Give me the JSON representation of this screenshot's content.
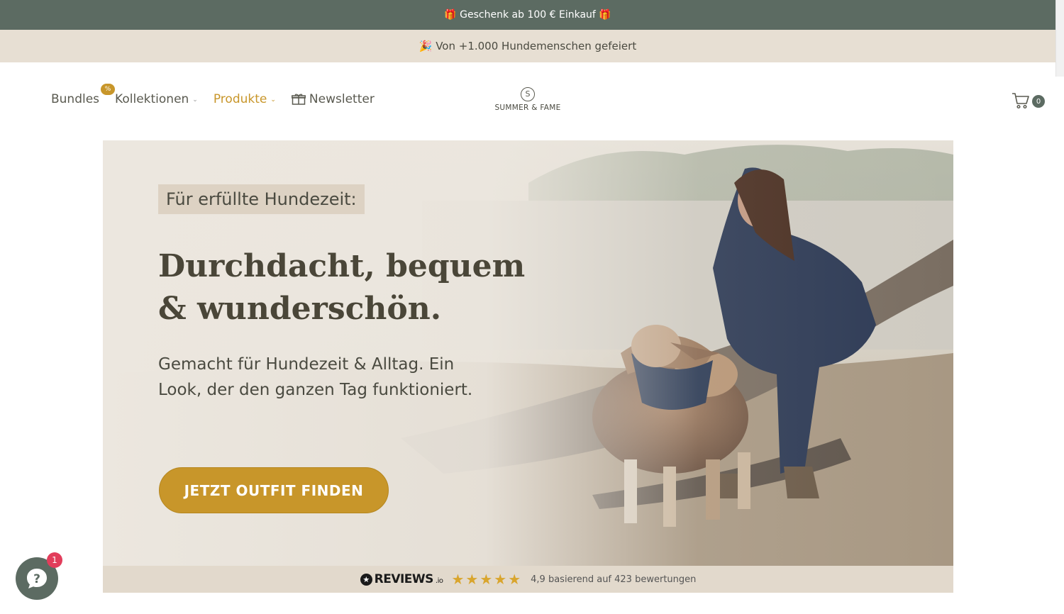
{
  "announcement": {
    "text": "🎁 Geschenk ab 100 € Einkauf 🎁"
  },
  "social_proof": {
    "text": "🎉 Von +1.000 Hundemenschen gefeiert"
  },
  "nav": {
    "items": [
      {
        "label": "Bundles",
        "badge": "%"
      },
      {
        "label": "Kollektionen"
      },
      {
        "label": "Produkte"
      },
      {
        "label": "Newsletter",
        "icon": "gift-icon"
      }
    ]
  },
  "logo": {
    "text": "SUMMER & FAME",
    "mark": "S"
  },
  "cart": {
    "count": "0"
  },
  "hero": {
    "kicker": "Für erfüllte Hundezeit:",
    "headline": "Durchdacht, bequem & wunderschön.",
    "subtitle": "Gemacht für Hundezeit & Alltag. Ein Look, der den ganzen Tag funktioniert.",
    "cta": "JETZT OUTFIT FINDEN"
  },
  "reviews": {
    "brand": "REVIEWS",
    "brand_suffix": ".io",
    "stars": "★★★★★",
    "rating": 4.9,
    "text": "4,9 basierend auf 423 bewertungen"
  },
  "chat": {
    "unread": "1"
  },
  "colors": {
    "header_bg": "#5c6b62",
    "accent": "#c8962a",
    "cream": "#e7dfd3",
    "notification": "#e23d5b"
  }
}
